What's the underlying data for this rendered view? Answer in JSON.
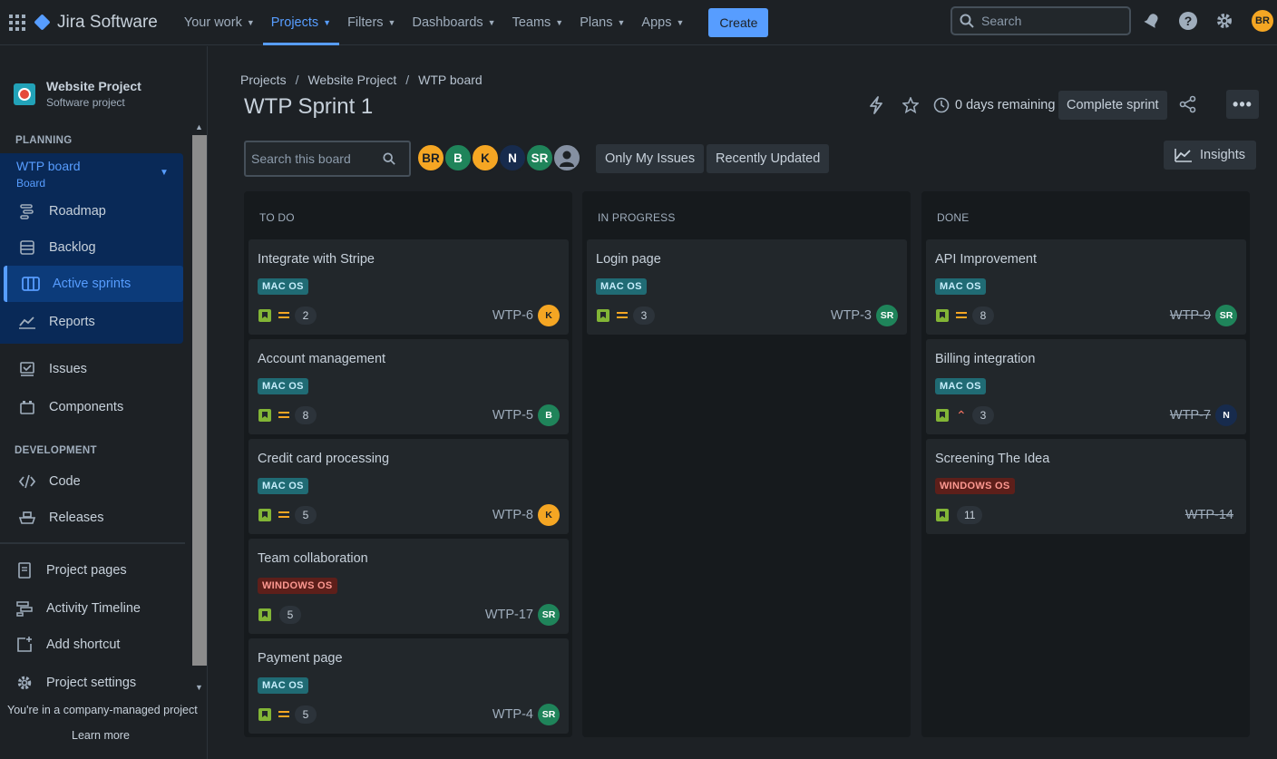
{
  "topnav": {
    "product": "Jira Software",
    "items": [
      {
        "label": "Your work"
      },
      {
        "label": "Projects"
      },
      {
        "label": "Filters"
      },
      {
        "label": "Dashboards"
      },
      {
        "label": "Teams"
      },
      {
        "label": "Plans"
      },
      {
        "label": "Apps"
      }
    ],
    "create_label": "Create",
    "search_placeholder": "Search",
    "user_initials": "BR"
  },
  "sidebar": {
    "project_name": "Website Project",
    "project_type": "Software project",
    "planning_label": "PLANNING",
    "board_name": "WTP board",
    "board_sub": "Board",
    "planning_items": [
      {
        "label": "Roadmap",
        "icon": "roadmap-icon"
      },
      {
        "label": "Backlog",
        "icon": "backlog-icon"
      },
      {
        "label": "Active sprints",
        "icon": "board-icon"
      },
      {
        "label": "Reports",
        "icon": "reports-icon"
      }
    ],
    "other_items": [
      {
        "label": "Issues",
        "icon": "issues-icon"
      },
      {
        "label": "Components",
        "icon": "components-icon"
      }
    ],
    "development_label": "DEVELOPMENT",
    "dev_items": [
      {
        "label": "Code",
        "icon": "code-icon"
      },
      {
        "label": "Releases",
        "icon": "releases-icon"
      }
    ],
    "bottom_items": [
      {
        "label": "Project pages",
        "icon": "page-icon"
      },
      {
        "label": "Activity Timeline",
        "icon": "timeline-icon"
      },
      {
        "label": "Add shortcut",
        "icon": "add-shortcut-icon"
      },
      {
        "label": "Project settings",
        "icon": "gear-icon"
      }
    ],
    "company_note": "You're in a company-managed project",
    "learn_more": "Learn more"
  },
  "main": {
    "breadcrumb": [
      "Projects",
      "Website Project",
      "WTP board"
    ],
    "title": "WTP Sprint 1",
    "days_remaining": "0 days remaining",
    "complete_sprint": "Complete sprint",
    "board_search_placeholder": "Search this board",
    "avatars": [
      {
        "initials": "BR",
        "color": "orange"
      },
      {
        "initials": "B",
        "color": "green"
      },
      {
        "initials": "K",
        "color": "orange"
      },
      {
        "initials": "N",
        "color": "navy"
      },
      {
        "initials": "SR",
        "color": "green"
      }
    ],
    "only_my_issues": "Only My Issues",
    "recently_updated": "Recently Updated",
    "insights": "Insights"
  },
  "columns": [
    {
      "title": "TO DO",
      "cards": [
        {
          "title": "Integrate with Stripe",
          "label": "MAC OS",
          "points": "2",
          "key": "WTP-6",
          "assignee": "K"
        },
        {
          "title": "Account management",
          "label": "MAC OS",
          "points": "8",
          "key": "WTP-5",
          "assignee": "B"
        },
        {
          "title": "Credit card processing",
          "label": "MAC OS",
          "points": "5",
          "key": "WTP-8",
          "assignee": "K"
        },
        {
          "title": "Team collaboration",
          "label": "WINDOWS OS",
          "points": "5",
          "key": "WTP-17",
          "assignee": "SR"
        },
        {
          "title": "Payment page",
          "label": "MAC OS",
          "points": "5",
          "key": "WTP-4",
          "assignee": "SR"
        }
      ]
    },
    {
      "title": "IN PROGRESS",
      "cards": [
        {
          "title": "Login page",
          "label": "MAC OS",
          "points": "3",
          "key": "WTP-3",
          "assignee": "SR"
        }
      ]
    },
    {
      "title": "DONE",
      "cards": [
        {
          "title": "API Improvement",
          "label": "MAC OS",
          "points": "8",
          "key": "WTP-9",
          "assignee": "SR"
        },
        {
          "title": "Billing integration",
          "label": "MAC OS",
          "points": "3",
          "key": "WTP-7",
          "assignee": "N"
        },
        {
          "title": "Screening The Idea",
          "label": "WINDOWS OS",
          "points": "11",
          "key": "WTP-14",
          "assignee": ""
        }
      ]
    }
  ],
  "colors": {
    "accent": "#579dff",
    "background": "#1d2125",
    "card": "#22272b",
    "column": "#161a1d"
  }
}
